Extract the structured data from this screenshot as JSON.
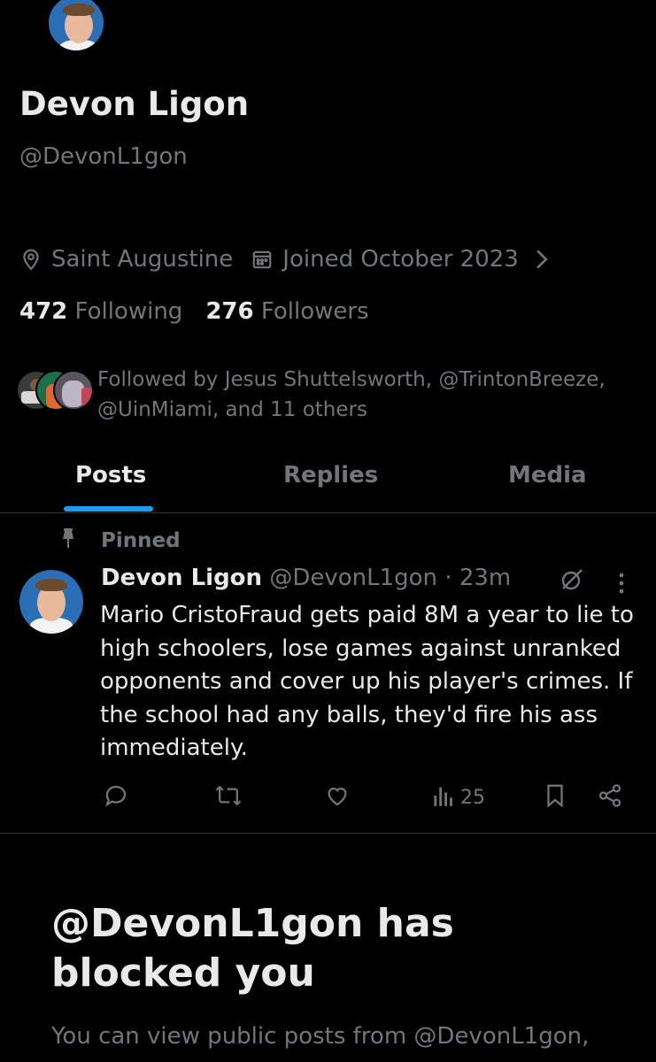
{
  "profile": {
    "display_name": "Devon Ligon",
    "handle": "@DevonL1gon",
    "location": "Saint Augustine",
    "joined": "Joined October 2023",
    "following_count": "472",
    "following_label": "Following",
    "followers_count": "276",
    "followers_label": "Followers",
    "followed_by": "Followed by Jesus Shuttelsworth, @TrintonBreeze, @UinMiami, and 11 others"
  },
  "tabs": [
    {
      "label": "Posts",
      "active": true
    },
    {
      "label": "Replies",
      "active": false
    },
    {
      "label": "Media",
      "active": false
    }
  ],
  "post": {
    "pinned_label": "Pinned",
    "author": "Devon Ligon",
    "handle": "@DevonL1gon",
    "time": "· 23m",
    "text": "Mario CristoFraud gets paid 8M a year to lie to high schoolers, lose games against unranked opponents and cover up his player's crimes. If the school had any balls, they'd fire his ass immediately.",
    "views": "25"
  },
  "blocked": {
    "title": "@DevonL1gon has blocked you",
    "text": "You can view public posts from @DevonL1gon,"
  },
  "colors": {
    "background": "#000000",
    "text": "#e7e9ea",
    "muted": "#71767b",
    "accent": "#1d9bf0",
    "divider": "#2f3336"
  },
  "icons": [
    "location-pin-icon",
    "calendar-icon",
    "chevron-right-icon",
    "pin-icon",
    "grok-icon",
    "more-icon",
    "reply-icon",
    "repost-icon",
    "like-icon",
    "views-icon",
    "bookmark-icon",
    "share-icon"
  ]
}
